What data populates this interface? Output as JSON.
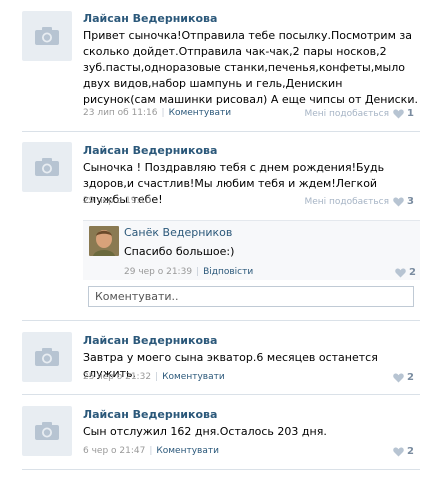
{
  "posts": [
    {
      "author": "Лайсан Ведерникова",
      "text": "Привет сыночка!Отправила тебе посылку.Посмотрим за сколько дойдет.Отправила чак-чак,2 пары носков,2 зуб.пасты,одноразовые станки,печенья,конфеты,мыло двух видов,набор шампунь и гель,Денискин рисунок(сам машинки рисовал) А еще чипсы от Дениски.",
      "date": "23 лип об 11:16",
      "comment_link": "Коментувати",
      "like_label": "Мені подобається",
      "like_count": "1"
    },
    {
      "author": "Лайсан Ведерникова",
      "text": "Сыночка ! Поздравляю тебя с днем рождения!Будь здоров,и счастлив!Мы любим тебя и ждем!Легкой службы тебе!",
      "date": "29 чер о 19:10",
      "like_label": "Мені подобається",
      "like_count": "3",
      "reply": {
        "author": "Санёк Ведерников",
        "text": "Спасибо большое:)",
        "date": "29 чер о 21:39",
        "reply_link": "Відповісти",
        "like_count": "2"
      },
      "comment_placeholder": "Коментувати.."
    },
    {
      "author": "Лайсан Ведерникова",
      "text": "Завтра у моего сына экватор.6 месяцев останется служить.",
      "date": "25 чер о 21:32",
      "comment_link": "Коментувати",
      "like_count": "2"
    },
    {
      "author": "Лайсан Ведерникова",
      "text": "Сын отслужил 162 дня.Осталось 203 дня.",
      "date": "6 чер о 21:47",
      "comment_link": "Коментувати",
      "like_count": "2"
    }
  ],
  "colors": {
    "link": "#2b587a",
    "meta": "#999999",
    "separator": "#dae1e8",
    "avatar_bg": "#e8edf2"
  },
  "icons": [
    "camera-icon",
    "heart-icon"
  ]
}
